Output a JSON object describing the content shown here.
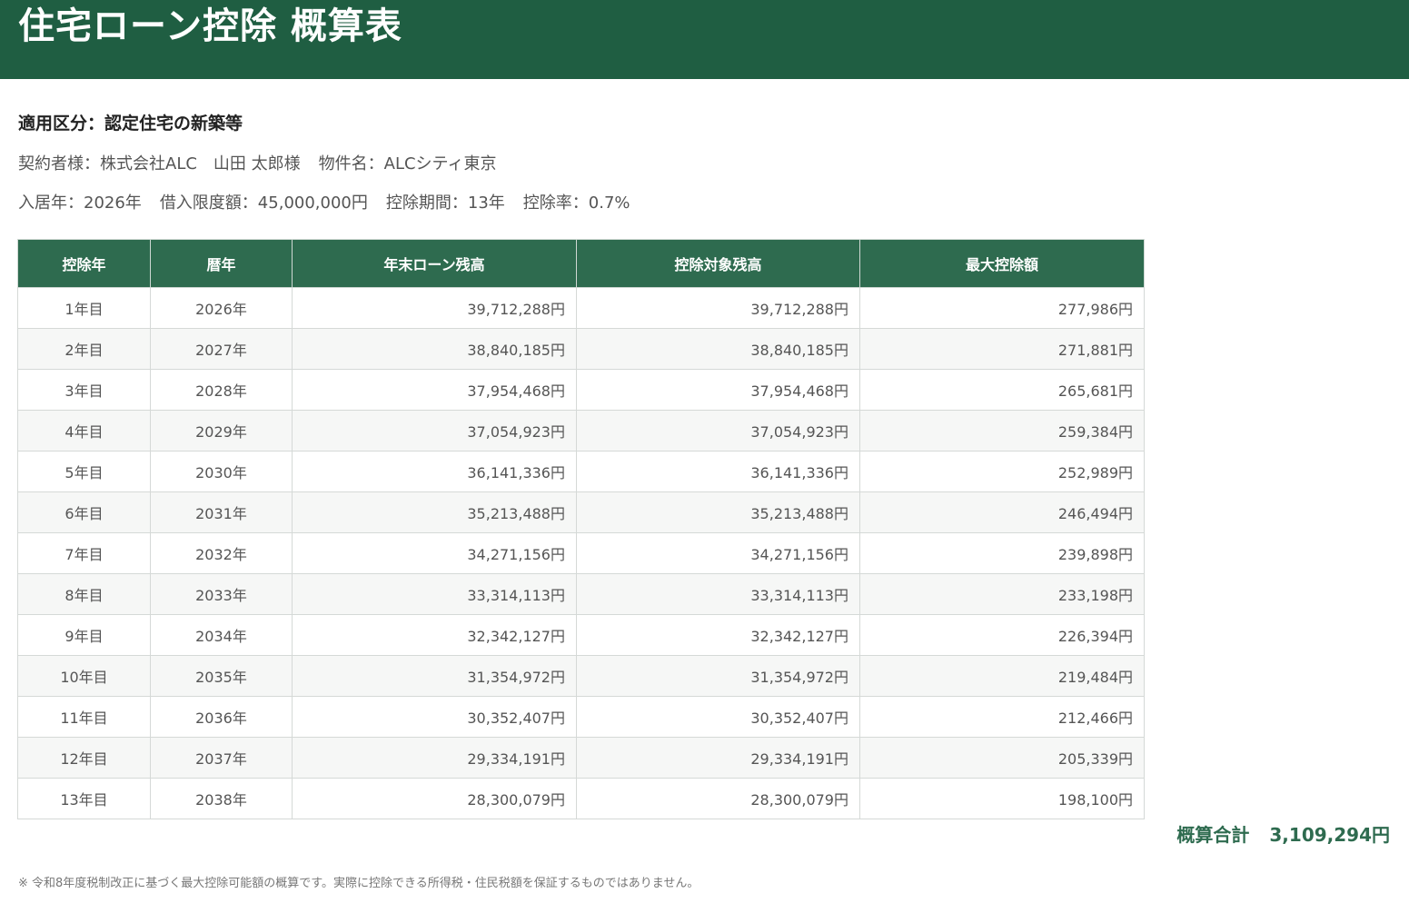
{
  "header": {
    "title": "住宅ローン控除 概算表"
  },
  "summary": {
    "category": "適用区分：認定住宅の新築等",
    "contractor": "契約者様：株式会社ALC　山田 太郎様",
    "property": "物件名：ALCシティ東京",
    "move_in_year": "入居年：2026年",
    "loan_limit": "借入限度額：45,000,000円",
    "deduction_period": "控除期間：13年",
    "deduction_rate": "控除率：0.7%"
  },
  "table": {
    "columns": [
      "控除年",
      "暦年",
      "年末ローン残高",
      "控除対象残高",
      "最大控除額"
    ],
    "rows": [
      [
        "1年目",
        "2026年",
        "39,712,288円",
        "39,712,288円",
        "277,986円"
      ],
      [
        "2年目",
        "2027年",
        "38,840,185円",
        "38,840,185円",
        "271,881円"
      ],
      [
        "3年目",
        "2028年",
        "37,954,468円",
        "37,954,468円",
        "265,681円"
      ],
      [
        "4年目",
        "2029年",
        "37,054,923円",
        "37,054,923円",
        "259,384円"
      ],
      [
        "5年目",
        "2030年",
        "36,141,336円",
        "36,141,336円",
        "252,989円"
      ],
      [
        "6年目",
        "2031年",
        "35,213,488円",
        "35,213,488円",
        "246,494円"
      ],
      [
        "7年目",
        "2032年",
        "34,271,156円",
        "34,271,156円",
        "239,898円"
      ],
      [
        "8年目",
        "2033年",
        "33,314,113円",
        "33,314,113円",
        "233,198円"
      ],
      [
        "9年目",
        "2034年",
        "32,342,127円",
        "32,342,127円",
        "226,394円"
      ],
      [
        "10年目",
        "2035年",
        "31,354,972円",
        "31,354,972円",
        "219,484円"
      ],
      [
        "11年目",
        "2036年",
        "30,352,407円",
        "30,352,407円",
        "212,466円"
      ],
      [
        "12年目",
        "2037年",
        "29,334,191円",
        "29,334,191円",
        "205,339円"
      ],
      [
        "13年目",
        "2038年",
        "28,300,079円",
        "28,300,079円",
        "198,100円"
      ]
    ]
  },
  "total": {
    "label": "概算合計",
    "value": "3,109,294円"
  },
  "note": "※ 令和8年度税制改正に基づく最大控除可能額の概算です。実際に控除できる所得税・住民税額を保証するものではありません。",
  "colors": {
    "header_bg": "#1f5e42",
    "table_header_bg": "#2e6b4f",
    "total_text": "#2e6b4f"
  }
}
